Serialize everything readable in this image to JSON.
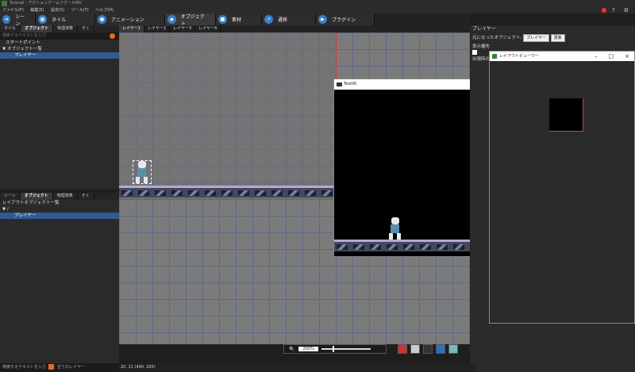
{
  "window": {
    "title": "Tutorial - アクションゲームツクールMV"
  },
  "menu": [
    "ファイル(F)",
    "編集(E)",
    "設定(S)",
    "ツール(T)",
    "ヘルプ(H)"
  ],
  "main_tabs": [
    "シーン",
    "タイル",
    "アニメーション",
    "オブジェクト",
    "素材",
    "遷移",
    "プラグイン"
  ],
  "object_panel": {
    "tabs": [
      "タイル",
      "オブジェクト",
      "物理演算",
      "そく"
    ],
    "search_placeholder": "検索するテキストを入力",
    "items": [
      "スタートポイント",
      "オブジェクト一覧",
      "プレイヤー"
    ]
  },
  "layout_panel": {
    "tabs": [
      "シーン",
      "オブジェクト",
      "物理演算",
      "そく"
    ],
    "title": "レイアウトオブジェクト一覧",
    "root": "/",
    "items": [
      "プレイヤー"
    ],
    "search_placeholder": "検索するテキストを入力",
    "all_layers": "全てのレイヤー"
  },
  "layer_tabs": [
    "レイヤー1",
    "レイヤー2",
    "レイヤー3",
    "レイヤー4"
  ],
  "right_panel": {
    "title": "プレイヤー",
    "base_object_label": "元になったオブジェクト:",
    "base_object_value": "プレイヤー",
    "update_button": "更新",
    "display_label": "表示優先",
    "appear_label": "出現時の"
  },
  "layout_viewer": {
    "title": "レイアウトビューワー"
  },
  "game_window": {
    "title": "Test00"
  },
  "zoom": {
    "value": "200%"
  },
  "status": {
    "coords": "20, 11 (490, 265)"
  },
  "icons": {
    "close": "×",
    "minimize": "–",
    "maximize": "□",
    "help": "?",
    "settings": "⚙"
  }
}
